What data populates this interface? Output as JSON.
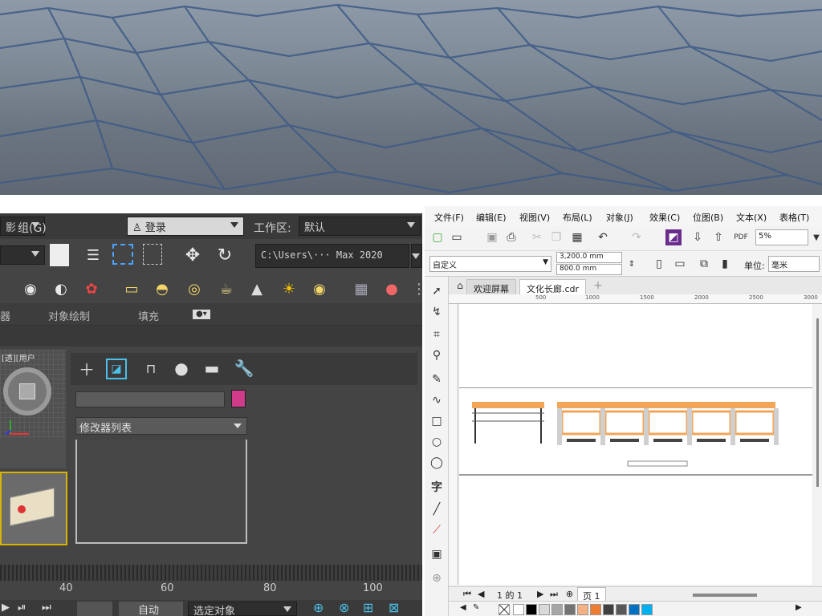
{
  "max": {
    "menu": {
      "group_label": "组(G)",
      "login_label": "登录",
      "workspace_label": "工作区:",
      "workspace_value": "默认",
      "left_dd_value": "影"
    },
    "toolbar": {
      "path_value": "C:\\Users\\··· Max 2020"
    },
    "ribbon_tabs": [
      "器",
      "对象绘制",
      "填充"
    ],
    "command_panel": {
      "modifier_list_label": "修改器列表"
    },
    "viewport_label": "[透][用户",
    "timeline_ticks": [
      "40",
      "60",
      "80",
      "100"
    ],
    "bottom": {
      "auto_label": "自动",
      "selection_label": "选定对象"
    },
    "colors": {
      "accent": "#d6b400",
      "color_swatch": "#d23a8a"
    },
    "icons": [
      "move-icon",
      "rotate-icon",
      "plus-icon",
      "modify-icon",
      "hierarchy-icon",
      "motion-icon",
      "display-icon",
      "utilities-icon"
    ]
  },
  "corel": {
    "menu": [
      "文件(F)",
      "编辑(E)",
      "视图(V)",
      "布局(L)",
      "对象(J)",
      "效果(C)",
      "位图(B)",
      "文本(X)",
      "表格(T)"
    ],
    "toolbar": {
      "zoom_value": "5%",
      "preset_value": "自定义",
      "width_value": "3,200.0 mm",
      "height_value": "800.0 mm",
      "unit_label": "单位:",
      "unit_value": "毫米"
    },
    "doc_tabs": [
      "欢迎屏幕",
      "文化长廊.cdr"
    ],
    "ruler_ticks": [
      "500",
      "1000",
      "1500",
      "2000",
      "2500",
      "3000"
    ],
    "pagebar": {
      "page_info": "1 的 1",
      "page_tab": "页 1"
    },
    "tools_text_label": "字",
    "colors": [
      "#ffffff",
      "#000000",
      "#d9d9d9",
      "#a6a6a6",
      "#737373",
      "#f4b183",
      "#ed7d31",
      "#404040",
      "#595959",
      "#0070c0",
      "#00b0f0"
    ]
  }
}
